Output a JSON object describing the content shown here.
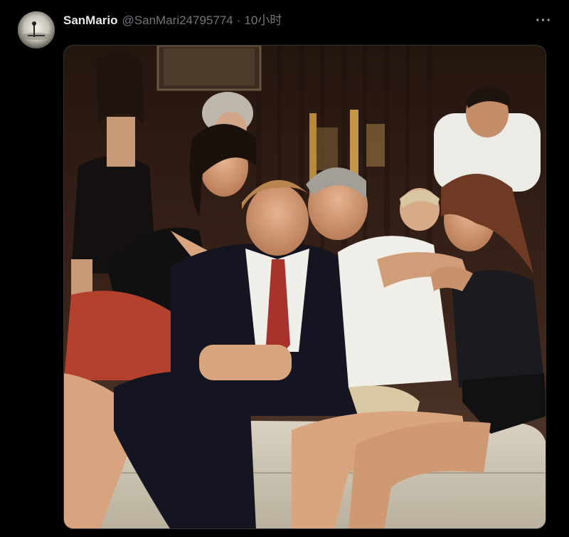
{
  "tweet": {
    "display_name": "SanMario",
    "handle": "@SanMari24795774",
    "separator": "·",
    "time": "10小时",
    "more_glyph": "···"
  },
  "media": {
    "kind": "photo"
  },
  "icons": {
    "avatar": "avatar-icon",
    "more": "more-options-icon"
  },
  "colors": {
    "background": "#000000",
    "primary_text": "#e7e9ea",
    "secondary_text": "#71767b",
    "border": "#2f3336"
  }
}
